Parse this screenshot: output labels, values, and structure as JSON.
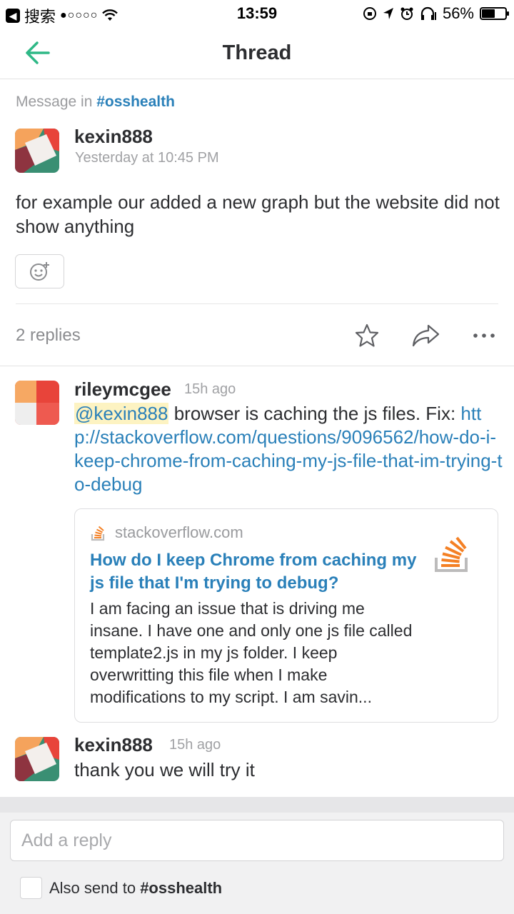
{
  "status_bar": {
    "back_app": "搜索",
    "signal": "●○○○○",
    "time": "13:59",
    "battery": "56%",
    "battery_level": 0.56
  },
  "nav": {
    "title": "Thread"
  },
  "context": {
    "prefix": "Message in ",
    "channel": "#osshealth"
  },
  "parent": {
    "username": "kexin888",
    "timestamp": "Yesterday at 10:45 PM",
    "text": "for example our added a new graph  but the website did  not show anything"
  },
  "thread_meta": {
    "replies": "2 replies"
  },
  "replies": [
    {
      "username": "rileymcgee",
      "timestamp": "15h ago",
      "mention": "@kexin888",
      "text": " browser is caching the js files. Fix: ",
      "link": "http://stackoverflow.com/questions/9096562/how-do-i-keep-chrome-from-caching-my-js-file-that-im-trying-to-debug"
    },
    {
      "username": "kexin888",
      "timestamp": "15h ago",
      "text": "thank you we will try it"
    }
  ],
  "unfurl": {
    "site": "stackoverflow.com",
    "title": "How do I keep Chrome from caching my js file that I'm trying to debug?",
    "description": "I am facing an issue that is driving me insane. I have one and only one js file called template2.js in my js folder. I keep overwritting this file when I make modifications to my script. I am savin..."
  },
  "composer": {
    "placeholder": "Add a reply",
    "also_send_prefix": "Also send to ",
    "also_send_channel": "#osshealth"
  },
  "colors": {
    "accent": "#2eb886",
    "link": "#2a80b9",
    "mention_bg": "#fdf3c2"
  }
}
